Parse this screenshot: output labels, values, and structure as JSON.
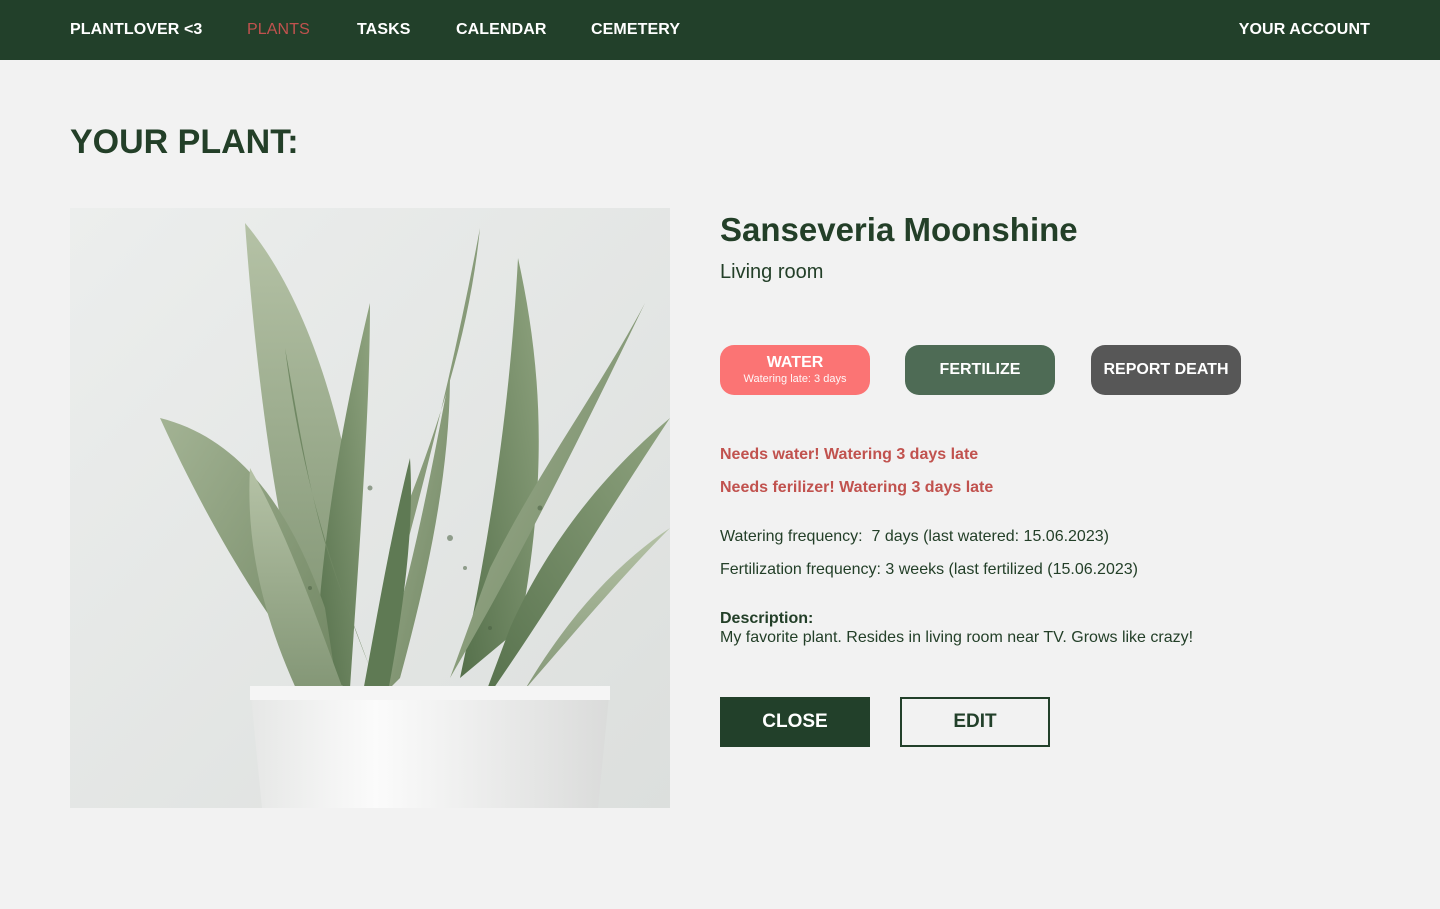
{
  "nav": {
    "brand": "PLANTLOVER <3",
    "items": [
      {
        "label": "PLANTS",
        "active": true
      },
      {
        "label": "TASKS",
        "active": false
      },
      {
        "label": "CALENDAR",
        "active": false
      },
      {
        "label": "CEMETERY",
        "active": false
      }
    ],
    "account": "YOUR ACCOUNT"
  },
  "page": {
    "title": "YOUR PLANT:"
  },
  "plant": {
    "name": "Sanseveria Moonshine",
    "room": "Living room",
    "photo_icon": "snake-plant-photo"
  },
  "actions": {
    "water_label": "WATER",
    "water_sub": "Watering late: 3 days",
    "fertilize_label": "FERTILIZE",
    "report_death_label": "REPORT DEATH"
  },
  "alerts": {
    "water": "Needs water! Watering 3 days late",
    "fertilizer": "Needs ferilizer! Watering 3 days late"
  },
  "info": {
    "watering": "Watering frequency:  7 days (last watered: 15.06.2023)",
    "fertilization": "Fertilization frequency: 3 weeks (last fertilized (15.06.2023)"
  },
  "description": {
    "label": "Description:",
    "text": "My favorite plant. Resides in living room near TV. Grows like crazy!"
  },
  "footer_buttons": {
    "close_label": "CLOSE",
    "edit_label": "EDIT"
  },
  "colors": {
    "primary": "#22402a",
    "accent_red": "#c1524e",
    "water_button": "#fb7474",
    "fertilize_button": "#4e6b55",
    "death_button": "#575757",
    "background": "#f2f2f2"
  }
}
